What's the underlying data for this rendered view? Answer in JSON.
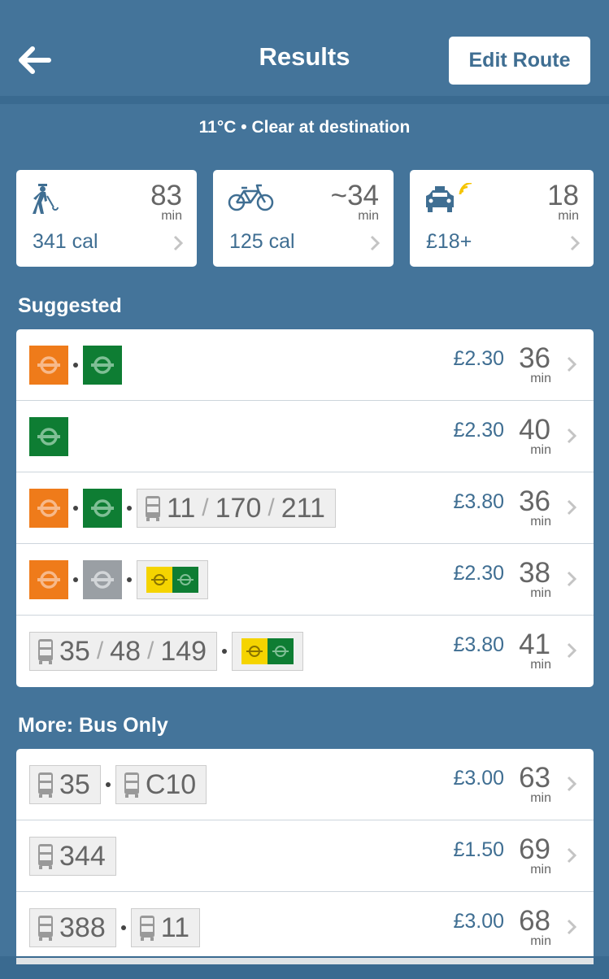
{
  "header": {
    "title": "Results",
    "edit_label": "Edit Route"
  },
  "weather": "11°C • Clear at destination",
  "modes": [
    {
      "icon": "walk-icon",
      "time": "83",
      "unit": "min",
      "sub": "341 cal"
    },
    {
      "icon": "bike-icon",
      "time": "~34",
      "unit": "min",
      "sub": "125 cal"
    },
    {
      "icon": "taxi-icon",
      "time": "18",
      "unit": "min",
      "sub": "£18+"
    }
  ],
  "suggested_label": "Suggested",
  "suggested": [
    {
      "price": "£2.30",
      "time": "36",
      "unit": "min"
    },
    {
      "price": "£2.30",
      "time": "40",
      "unit": "min"
    },
    {
      "price": "£3.80",
      "time": "36",
      "unit": "min",
      "bus": [
        "11",
        "170",
        "211"
      ]
    },
    {
      "price": "£2.30",
      "time": "38",
      "unit": "min"
    },
    {
      "price": "£3.80",
      "time": "41",
      "unit": "min",
      "bus": [
        "35",
        "48",
        "149"
      ]
    }
  ],
  "more_label": "More: Bus Only",
  "bus_only": [
    {
      "price": "£3.00",
      "time": "63",
      "unit": "min",
      "buses": [
        "35",
        "C10"
      ]
    },
    {
      "price": "£1.50",
      "time": "69",
      "unit": "min",
      "buses": [
        "344"
      ]
    },
    {
      "price": "£3.00",
      "time": "68",
      "unit": "min",
      "buses": [
        "388",
        "11"
      ]
    }
  ],
  "colors": {
    "background": "#44749a",
    "overground": "#ef7b1a",
    "district": "#0e7d33",
    "accent": "#3f6e92"
  }
}
